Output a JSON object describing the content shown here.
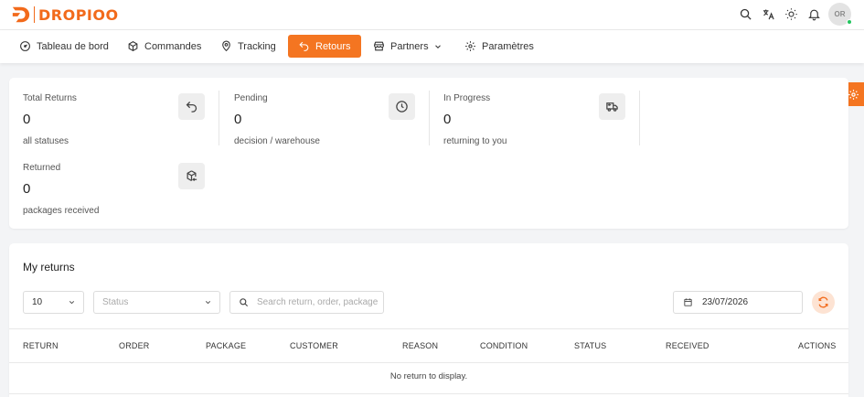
{
  "brand": {
    "name": "DROPIOO",
    "color": "#f26a1b"
  },
  "user": {
    "initials": "OR",
    "status_color": "#22c55e"
  },
  "topbar_icons": [
    "search-icon",
    "translate-icon",
    "sun-icon",
    "bell-icon"
  ],
  "nav": {
    "items": [
      {
        "label": "Tableau de bord",
        "icon": "dashboard-icon"
      },
      {
        "label": "Commandes",
        "icon": "box-icon"
      },
      {
        "label": "Tracking",
        "icon": "location-pin-icon"
      },
      {
        "label": "Retours",
        "icon": "return-arrow-icon",
        "active": true
      },
      {
        "label": "Partners",
        "icon": "store-icon"
      },
      {
        "label": "Paramètres",
        "icon": "gear-icon"
      }
    ],
    "active_color": "#f47521"
  },
  "stats": [
    {
      "label": "Total Returns",
      "value": "0",
      "sub": "all statuses",
      "icon": "return-arrow-icon"
    },
    {
      "label": "Pending",
      "value": "0",
      "sub": "decision / warehouse",
      "icon": "clock-icon"
    },
    {
      "label": "In Progress",
      "value": "0",
      "sub": "returning to you",
      "icon": "truck-return-icon"
    },
    {
      "label": "Returned",
      "value": "0",
      "sub": "packages received",
      "icon": "package-return-icon"
    }
  ],
  "returns": {
    "title": "My returns",
    "page_size": "10",
    "status_placeholder": "Status",
    "search_placeholder": "Search return, order, package",
    "date": "23/07/2026",
    "columns": [
      "RETURN",
      "ORDER",
      "PACKAGE",
      "CUSTOMER",
      "REASON",
      "CONDITION",
      "STATUS",
      "RECEIVED",
      "ACTIONS"
    ],
    "empty_message": "No return to display."
  }
}
